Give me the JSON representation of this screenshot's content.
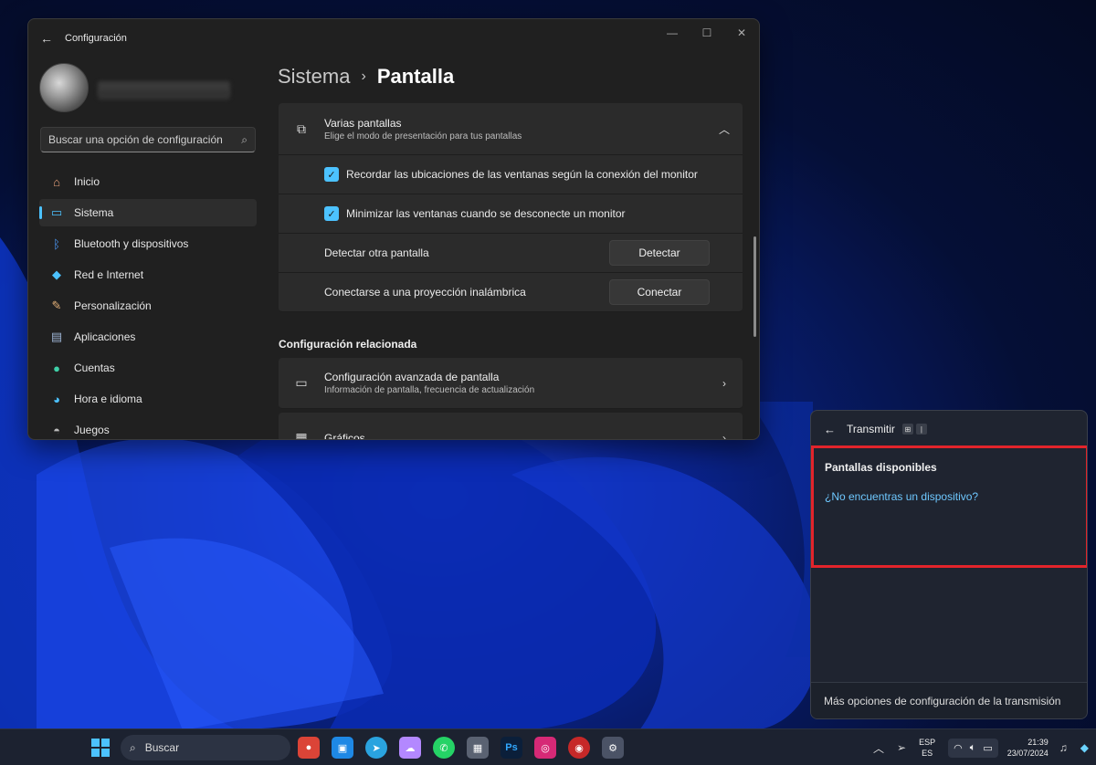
{
  "settings": {
    "title": "Configuración",
    "search_placeholder": "Buscar una opción de configuración",
    "nav": [
      {
        "label": "Inicio",
        "icon": "home-icon"
      },
      {
        "label": "Sistema",
        "icon": "system-icon"
      },
      {
        "label": "Bluetooth y dispositivos",
        "icon": "bluetooth-icon"
      },
      {
        "label": "Red e Internet",
        "icon": "network-icon"
      },
      {
        "label": "Personalización",
        "icon": "brush-icon"
      },
      {
        "label": "Aplicaciones",
        "icon": "apps-icon"
      },
      {
        "label": "Cuentas",
        "icon": "accounts-icon"
      },
      {
        "label": "Hora e idioma",
        "icon": "globe-icon"
      },
      {
        "label": "Juegos",
        "icon": "gamepad-icon"
      }
    ],
    "active_nav": "Sistema",
    "breadcrumb": {
      "parent": "Sistema",
      "current": "Pantalla"
    },
    "multi_display": {
      "title": "Varias pantallas",
      "subtitle": "Elige el modo de presentación para tus pantallas",
      "remember_label": "Recordar las ubicaciones de las ventanas según la conexión del monitor",
      "remember_checked": true,
      "minimize_label": "Minimizar las ventanas cuando se desconecte un monitor",
      "minimize_checked": true,
      "detect_label": "Detectar otra pantalla",
      "detect_button": "Detectar",
      "connect_label": "Conectarse a una proyección inalámbrica",
      "connect_button": "Conectar"
    },
    "related_title": "Configuración relacionada",
    "advanced": {
      "title": "Configuración avanzada de pantalla",
      "subtitle": "Información de pantalla, frecuencia de actualización"
    },
    "graphics": {
      "title": "Gráficos"
    }
  },
  "cast": {
    "title": "Transmitir",
    "available_heading": "Pantallas disponibles",
    "not_found_link": "¿No encuentras un dispositivo?",
    "footer": "Más opciones de configuración de la transmisión",
    "highlight_color": "#e2242b"
  },
  "taskbar": {
    "search_label": "Buscar",
    "apps": [
      {
        "icon": "chrome-icon",
        "color": "#db4437",
        "glyph": "●"
      },
      {
        "icon": "explorer-icon",
        "color": "#1e88e5",
        "glyph": "▣"
      },
      {
        "icon": "telegram-icon",
        "color": "#2aa3df",
        "glyph": "➤"
      },
      {
        "icon": "onedrive-icon",
        "color": "#b388ff",
        "glyph": "☁"
      },
      {
        "icon": "whatsapp-icon",
        "color": "#25d366",
        "glyph": "✆"
      },
      {
        "icon": "calculator-icon",
        "color": "#5a6272",
        "glyph": "▦"
      },
      {
        "icon": "photoshop-icon",
        "color": "#0b1f3a",
        "glyph": "Ps"
      },
      {
        "icon": "instagram-icon",
        "color": "#d62976",
        "glyph": "◎"
      },
      {
        "icon": "recorder-icon",
        "color": "#c62828",
        "glyph": "◉"
      },
      {
        "icon": "settings-icon",
        "color": "#4b5366",
        "glyph": "⚙"
      }
    ],
    "lang_top": "ESP",
    "lang_bottom": "ES",
    "time": "21:39",
    "date": "23/07/2024"
  }
}
